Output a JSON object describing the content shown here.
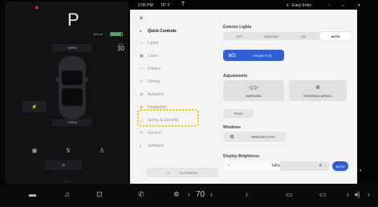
{
  "vehicle_panel": {
    "gear": "P",
    "range": "315 mi",
    "battery_level": 0.9,
    "speed_limit_label": "MAX",
    "speed_limit": "30",
    "frunk_label": "OPEN",
    "trunk_label": "OPEN",
    "charge_port_icon": "bolt-icon",
    "page_dots": "• • •"
  },
  "status_bar": {
    "time": "2:05 PM",
    "temperature": "75° F",
    "profile": "Easy Entry",
    "profile_icon": "person-icon"
  },
  "menu": {
    "items": [
      {
        "label": "Quick Controls",
        "icon": "car-icon",
        "glyph": "◐",
        "active": true
      },
      {
        "label": "Lights",
        "icon": "bulb-icon",
        "glyph": "☼",
        "active": false
      },
      {
        "label": "Locks",
        "icon": "lock-icon",
        "glyph": "🔒",
        "active": false
      },
      {
        "label": "Display",
        "icon": "display-icon",
        "glyph": "▭",
        "active": false
      },
      {
        "label": "Driving",
        "icon": "car-icon",
        "glyph": "⚇",
        "active": false
      },
      {
        "label": "Autopilot",
        "icon": "steering-icon",
        "glyph": "⊕",
        "active": false
      },
      {
        "label": "Navigation",
        "icon": "nav-icon",
        "glyph": "➤",
        "active": false
      },
      {
        "label": "Safety & Security",
        "icon": "shield-icon",
        "glyph": "ⓘ",
        "active": false
      },
      {
        "label": "Service",
        "icon": "wrench-icon",
        "glyph": "✎",
        "active": false
      },
      {
        "label": "Software",
        "icon": "download-icon",
        "glyph": "⤓",
        "active": false
      }
    ],
    "glovebox_label": "GLOVEBOX"
  },
  "exterior_lights": {
    "title": "Exterior Lights",
    "options": [
      "OFF",
      "PARKING",
      "ON",
      "AUTO"
    ],
    "selected": "AUTO",
    "front_fog_label": "FRONT FOG",
    "front_fog_on": true
  },
  "adjustments": {
    "title": "Adjustments",
    "mirrors_label": "MIRRORS",
    "steering_wheel_label": "STEERING WHEEL",
    "fold_label": "FOLD"
  },
  "windows": {
    "title": "Windows",
    "window_lock_label": "WINDOW LOCK"
  },
  "display_brightness": {
    "title": "Display Brightness",
    "value": "54%",
    "level": 0.54,
    "auto_label": "AUTO"
  },
  "dock": {
    "climate_temp": "70",
    "items": [
      "car-icon",
      "music-icon",
      "app-icon",
      "phone-icon",
      "fan-icon",
      "temp-icon",
      "seat-heater-icon",
      "defrost-icon",
      "rear-defrost-icon",
      "volume-icon"
    ]
  },
  "colors": {
    "accent": "#2d5fd6",
    "highlight": "#f0c400",
    "battery": "#2fbf3f",
    "alert": "#d33333"
  }
}
